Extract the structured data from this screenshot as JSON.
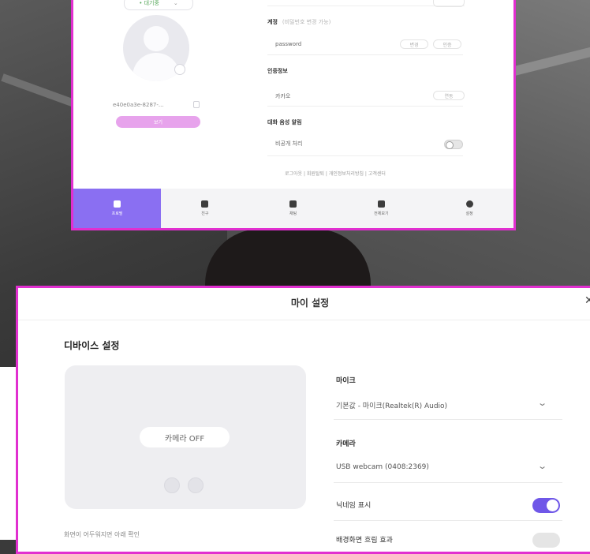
{
  "colors": {
    "accent": "#8a6ff2",
    "toggle_on": "#6f57e8",
    "highlight_border": "#e12fd0",
    "pink_button": "#e7a3ec"
  },
  "profile_panel": {
    "status": "• 대기중",
    "user_id": "e40e0a3e-8287-...",
    "pink_button": "보기",
    "fields": {
      "account_label": "계정",
      "account_sublabel": "(비밀번호 변경 가능)",
      "account_value": "password",
      "account_chip1": "변경",
      "account_chip2": "인증",
      "consent_label": "인증정보",
      "consent_value": "카카오",
      "consent_chip": "연동",
      "notify_label": "대화 음성 알림",
      "notify_value": "비공개 처리"
    },
    "footer_links": "로그아웃  |  회원탈퇴  |  개인정보처리방침  |  고객센터",
    "nav": [
      {
        "label": "프로필",
        "icon": "profile-icon",
        "active": true
      },
      {
        "label": "친구",
        "icon": "friends-icon",
        "active": false
      },
      {
        "label": "채팅",
        "icon": "chat-icon",
        "active": false
      },
      {
        "label": "전체보기",
        "icon": "list-icon",
        "active": false
      },
      {
        "label": "설정",
        "icon": "gear-icon",
        "active": false
      }
    ]
  },
  "modal": {
    "title": "마이 설정",
    "close": "✕",
    "section_title": "디바이스 설정",
    "camera_off_label": "카메라 OFF",
    "bottom_note": "화면이 어두워지면 아래 확인",
    "mic_label": "마이크",
    "mic_value": "기본값 - 마이크(Realtek(R) Audio)",
    "camera_label": "카메라",
    "camera_value": "USB webcam (0408:2369)",
    "show_name_label": "닉네임 표시",
    "show_name_on": true,
    "next_label": "배경화면 흐림 효과"
  }
}
